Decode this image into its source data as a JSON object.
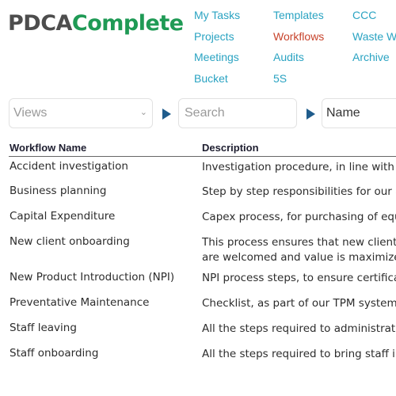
{
  "logo": {
    "part1": "PDCA",
    "part2": "Complete"
  },
  "nav": [
    {
      "label": "My Tasks",
      "active": false
    },
    {
      "label": "Projects",
      "active": false
    },
    {
      "label": "Meetings",
      "active": false
    },
    {
      "label": "Bucket",
      "active": false
    },
    {
      "label": "Templates",
      "active": false
    },
    {
      "label": "Workflows",
      "active": true
    },
    {
      "label": "Audits",
      "active": false
    },
    {
      "label": "5S",
      "active": false
    },
    {
      "label": "CCC",
      "active": false
    },
    {
      "label": "Waste Walk",
      "active": false
    },
    {
      "label": "Archive",
      "active": false
    }
  ],
  "toolbar": {
    "views_placeholder": "Views",
    "search_placeholder": "Search",
    "sort_value": "Name"
  },
  "table": {
    "headers": [
      "Workflow Name",
      "Description"
    ],
    "rows": [
      {
        "name": "Accident investigation",
        "description": "Investigation procedure, in line with our company policy"
      },
      {
        "name": "Business planning",
        "description": "Step by step responsibilities for our annual planning"
      },
      {
        "name": "Capital Expenditure",
        "description": "Capex process, for purchasing of equipment"
      },
      {
        "name": "New client onboarding",
        "description": "This process ensures that new clients are welcomed and value is maximized."
      },
      {
        "name": "New Product Introduction (NPI)",
        "description": "NPI process steps, to ensure certification"
      },
      {
        "name": "Preventative Maintenance",
        "description": "Checklist, as part of our TPM system"
      },
      {
        "name": "Staff leaving",
        "description": "All the steps required to administrate staff leaving"
      },
      {
        "name": "Staff onboarding",
        "description": "All the steps required to bring staff into the company"
      }
    ]
  }
}
